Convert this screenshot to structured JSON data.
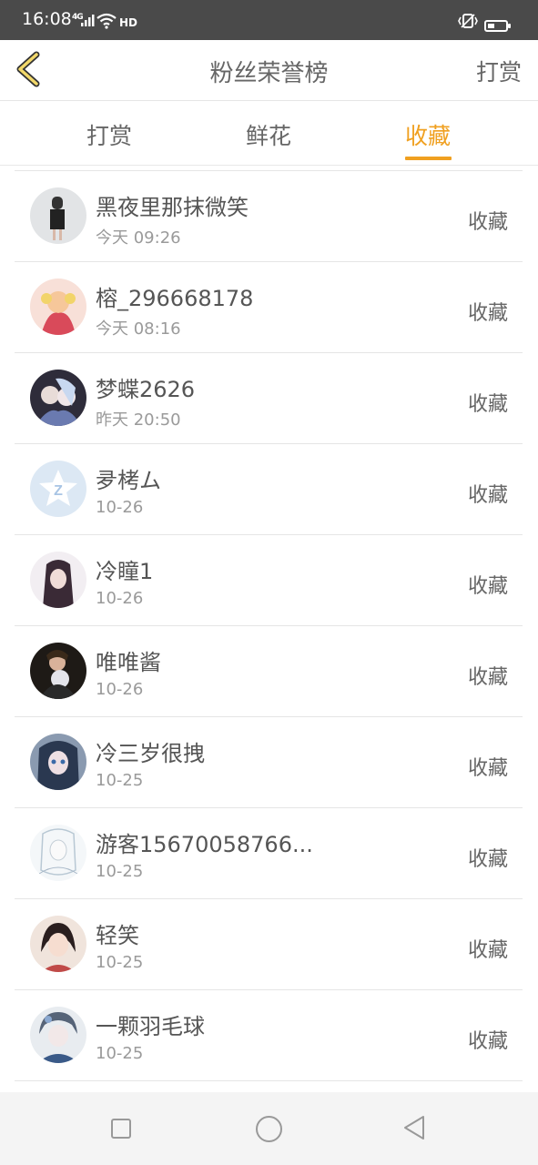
{
  "status": {
    "time": "16:08",
    "network": "4G",
    "hd": "HD",
    "icons": [
      "signal-icon",
      "wifi-icon",
      "hd-icon",
      "vibrate-icon",
      "battery-icon"
    ]
  },
  "header": {
    "title": "粉丝荣誉榜",
    "action": "打赏",
    "back_icon": "chevron-left-icon"
  },
  "tabs": [
    {
      "label": "打赏",
      "active": false
    },
    {
      "label": "鲜花",
      "active": false
    },
    {
      "label": "收藏",
      "active": true
    }
  ],
  "colors": {
    "accent": "#f0a020",
    "text": "#555555",
    "subtext": "#9a9a9a"
  },
  "list": [
    {
      "name": "黑夜里那抹微笑",
      "time": "今天 09:26",
      "tag": "收藏",
      "avatar_color": "#d8d8d8"
    },
    {
      "name": "榕_296668178",
      "time": "今天 08:16",
      "tag": "收藏",
      "avatar_color": "#f2c4b8"
    },
    {
      "name": "梦蝶2626",
      "time": "昨天 20:50",
      "tag": "收藏",
      "avatar_color": "#3c3a4a"
    },
    {
      "name": "夛栲ム",
      "time": "10-26",
      "tag": "收藏",
      "avatar_color": "#cfe0f2"
    },
    {
      "name": "冷瞳1",
      "time": "10-26",
      "tag": "收藏",
      "avatar_color": "#e6dfe6"
    },
    {
      "name": "唯唯酱",
      "time": "10-26",
      "tag": "收藏",
      "avatar_color": "#2b2824"
    },
    {
      "name": "冷三岁很拽",
      "time": "10-25",
      "tag": "收藏",
      "avatar_color": "#5a6e88"
    },
    {
      "name": "游客15670058766...",
      "time": "10-25",
      "tag": "收藏",
      "avatar_color": "#e8eef2"
    },
    {
      "name": "轻笑",
      "time": "10-25",
      "tag": "收藏",
      "avatar_color": "#c98a78"
    },
    {
      "name": "一颗羽毛球",
      "time": "10-25",
      "tag": "收藏",
      "avatar_color": "#8a98a8"
    }
  ],
  "navbar": [
    "recent-apps-icon",
    "home-icon",
    "back-icon"
  ]
}
